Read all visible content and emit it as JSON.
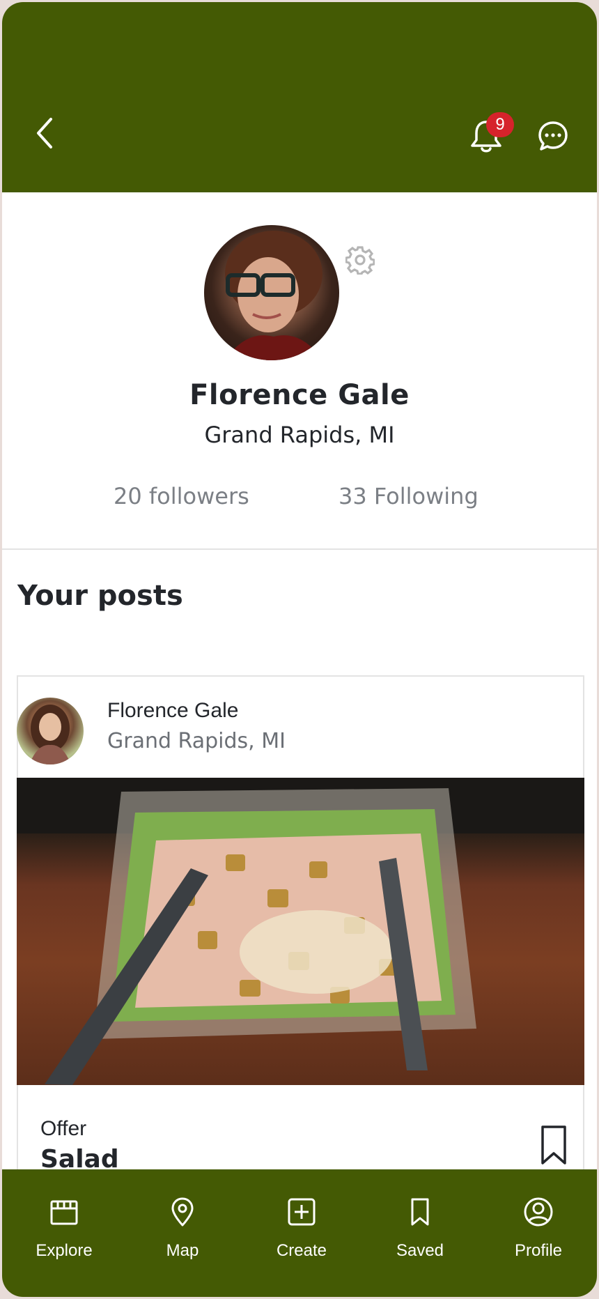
{
  "header": {
    "notification_count": "9",
    "icons": [
      "back-chevron-icon",
      "bell-icon",
      "chat-bubble-icon"
    ],
    "bar_color": "#445a04",
    "badge_color": "#d6232b"
  },
  "profile": {
    "name": "Florence Gale",
    "location": "Grand Rapids, MI",
    "followers": "20 followers",
    "following": "33 Following"
  },
  "posts_section": {
    "title": "Your posts"
  },
  "post": {
    "author": "Florence Gale",
    "location": "Grand Rapids, MI",
    "offer_label": "Offer",
    "offer_title": "Salad"
  },
  "bottom_nav": {
    "items": [
      {
        "label": "Explore",
        "icon": "storefront-icon"
      },
      {
        "label": "Map",
        "icon": "map-pin-icon"
      },
      {
        "label": "Create",
        "icon": "plus-square-icon"
      },
      {
        "label": "Saved",
        "icon": "bookmark-icon"
      },
      {
        "label": "Profile",
        "icon": "user-circle-icon"
      }
    ]
  }
}
